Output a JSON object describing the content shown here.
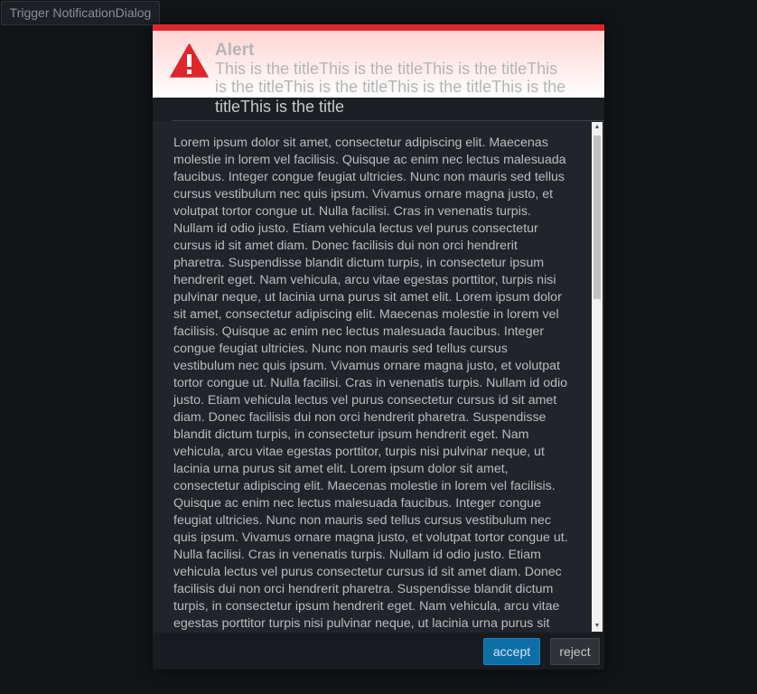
{
  "trigger": {
    "label": "Trigger NotificationDialog"
  },
  "dialog": {
    "alert_label": "Alert",
    "title_faded": "This is the titleThis is the titleThis is the titleThis is the titleThis is the titleThis is the titleThis is the",
    "title_visible": "titleThis is the title",
    "body": "Lorem ipsum dolor sit amet, consectetur adipiscing elit. Maecenas molestie in lorem vel facilisis. Quisque ac enim nec lectus malesuada faucibus. Integer congue feugiat ultricies. Nunc non mauris sed tellus cursus vestibulum nec quis ipsum. Vivamus ornare magna justo, et volutpat tortor congue ut. Nulla facilisi. Cras in venenatis turpis. Nullam id odio justo. Etiam vehicula lectus vel purus consectetur cursus id sit amet diam. Donec facilisis dui non orci hendrerit pharetra. Suspendisse blandit dictum turpis, in consectetur ipsum hendrerit eget. Nam vehicula, arcu vitae egestas porttitor, turpis nisi pulvinar neque, ut lacinia urna purus sit amet elit. Lorem ipsum dolor sit amet, consectetur adipiscing elit. Maecenas molestie in lorem vel facilisis. Quisque ac enim nec lectus malesuada faucibus. Integer congue feugiat ultricies. Nunc non mauris sed tellus cursus vestibulum nec quis ipsum. Vivamus ornare magna justo, et volutpat tortor congue ut. Nulla facilisi. Cras in venenatis turpis. Nullam id odio justo. Etiam vehicula lectus vel purus consectetur cursus id sit amet diam. Donec facilisis dui non orci hendrerit pharetra. Suspendisse blandit dictum turpis, in consectetur ipsum hendrerit eget. Nam vehicula, arcu vitae egestas porttitor, turpis nisi pulvinar neque, ut lacinia urna purus sit amet elit. Lorem ipsum dolor sit amet, consectetur adipiscing elit. Maecenas molestie in lorem vel facilisis. Quisque ac enim nec lectus malesuada faucibus. Integer congue feugiat ultricies. Nunc non mauris sed tellus cursus vestibulum nec quis ipsum. Vivamus ornare magna justo, et volutpat tortor congue ut. Nulla facilisi. Cras in venenatis turpis. Nullam id odio justo. Etiam vehicula lectus vel purus consectetur cursus id sit amet diam. Donec facilisis dui non orci hendrerit pharetra. Suspendisse blandit dictum turpis, in consectetur ipsum hendrerit eget. Nam vehicula, arcu vitae egestas porttitor turpis nisi pulvinar neque, ut lacinia urna purus sit amet elit.",
    "accept_label": "accept",
    "reject_label": "reject",
    "icon": "alert-triangle-icon"
  },
  "colors": {
    "alert_red": "#e0262b",
    "accept_blue": "#0d6fa8",
    "page_background": "#111417"
  }
}
